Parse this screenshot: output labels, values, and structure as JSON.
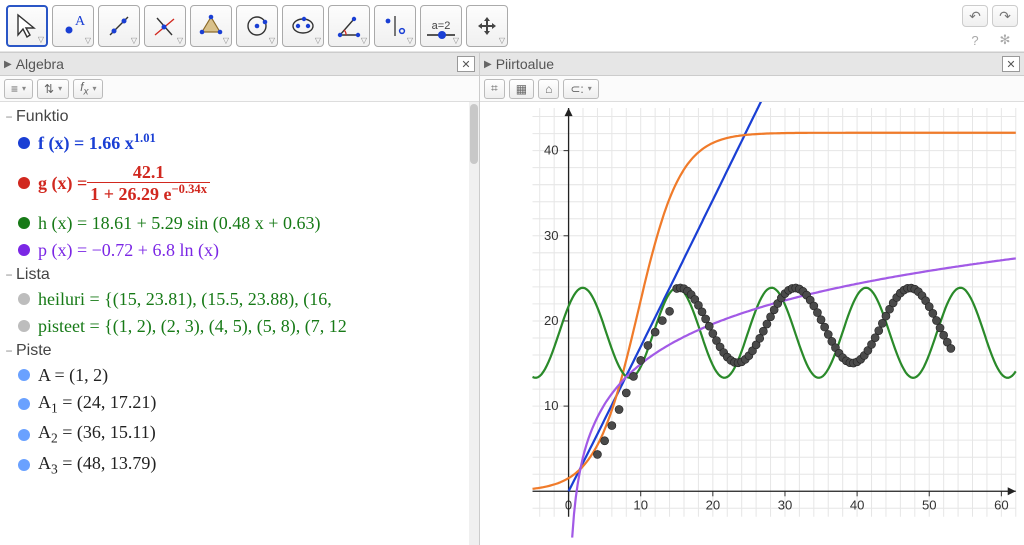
{
  "panels": {
    "algebra": {
      "title": "Algebra"
    },
    "graphics": {
      "title": "Piirtoalue"
    }
  },
  "algebra": {
    "categories": {
      "funktio": "Funktio",
      "lista": "Lista",
      "piste": "Piste"
    },
    "funktio": {
      "f": {
        "lhs": "f (x)  =  ",
        "coef": "1.66 x",
        "exp": "1.01"
      },
      "g": {
        "lhs": "g (x)  =  ",
        "num": "42.1",
        "denA": "1 + 26.29 e",
        "denExp": "−0.34x"
      },
      "h": {
        "expr": "h (x)  =  18.61 + 5.29  sin (0.48 x + 0.63)"
      },
      "p": {
        "expr": "p (x)  =  −0.72 + 6.8  ln (x)"
      }
    },
    "lista": {
      "heiluri": "heiluri = {(15, 23.81), (15.5, 23.88), (16,",
      "pisteet": "pisteet = {(1, 2), (2, 3), (4, 5), (5, 8), (7, 12"
    },
    "piste": {
      "A": "A  =  (1, 2)",
      "A1": {
        "pre": "A",
        "sub": "1",
        "rest": "  =  (24, 17.21)"
      },
      "A2": {
        "pre": "A",
        "sub": "2",
        "rest": "  =  (36, 15.11)"
      },
      "A3": {
        "pre": "A",
        "sub": "3",
        "rest": "  =  (48, 13.79)"
      }
    }
  },
  "toolbar": {
    "azLabel": "a=2"
  },
  "chart_data": {
    "type": "line+scatter",
    "xlim": [
      -5,
      62
    ],
    "ylim": [
      -3,
      45
    ],
    "xticks": [
      0,
      10,
      20,
      30,
      40,
      50,
      60
    ],
    "yticks": [
      10,
      20,
      30,
      40
    ],
    "series": [
      {
        "name": "f(x)=1.66x^1.01",
        "color": "#1a3fd4",
        "fn": "1.66*Math.pow(x,1.01)",
        "clip_y": 60
      },
      {
        "name": "g(x)=42.1/(1+26.29e^-0.34x)",
        "color": "#f07b2a",
        "fn": "42.1/(1+26.29*Math.exp(-0.34*x))"
      },
      {
        "name": "h(x)=18.61+5.29sin(0.48x+0.63)",
        "color": "#2a8a2a",
        "fn": "18.61+5.29*Math.sin(0.48*x+0.63)"
      },
      {
        "name": "p(x)=-0.72+6.8ln(x)",
        "color": "#a25ae6",
        "fn": "-0.72+6.8*Math.log(x)",
        "xmin": 0.5
      }
    ],
    "points": [
      [
        4,
        4.32
      ],
      [
        5,
        5.93
      ],
      [
        6,
        7.71
      ],
      [
        7,
        9.6
      ],
      [
        8,
        11.55
      ],
      [
        9,
        13.49
      ],
      [
        10,
        15.37
      ],
      [
        11,
        17.12
      ],
      [
        12,
        18.69
      ],
      [
        13,
        20.04
      ],
      [
        14,
        21.13
      ],
      [
        15,
        23.81
      ],
      [
        15.5,
        23.88
      ],
      [
        16,
        23.78
      ],
      [
        16.5,
        23.51
      ],
      [
        17,
        23.09
      ],
      [
        17.5,
        22.52
      ],
      [
        18,
        21.84
      ],
      [
        18.5,
        21.07
      ],
      [
        19,
        20.24
      ],
      [
        19.5,
        19.38
      ],
      [
        20,
        18.52
      ],
      [
        20.5,
        17.7
      ],
      [
        21,
        16.95
      ],
      [
        21.5,
        16.29
      ],
      [
        22,
        15.76
      ],
      [
        22.5,
        15.37
      ],
      [
        23,
        15.14
      ],
      [
        23.5,
        15.09
      ],
      [
        24,
        15.2
      ],
      [
        24.5,
        15.49
      ],
      [
        25,
        15.92
      ],
      [
        25.5,
        16.5
      ],
      [
        26,
        17.19
      ],
      [
        26.5,
        17.96
      ],
      [
        27,
        18.79
      ],
      [
        27.5,
        19.64
      ],
      [
        28,
        20.49
      ],
      [
        28.5,
        21.31
      ],
      [
        29,
        22.05
      ],
      [
        29.5,
        22.7
      ],
      [
        30,
        23.22
      ],
      [
        30.5,
        23.6
      ],
      [
        31,
        23.82
      ],
      [
        31.5,
        23.87
      ],
      [
        32,
        23.75
      ],
      [
        32.5,
        23.47
      ],
      [
        33,
        23.03
      ],
      [
        33.5,
        22.45
      ],
      [
        34,
        21.76
      ],
      [
        34.5,
        20.98
      ],
      [
        35,
        20.14
      ],
      [
        35.5,
        19.28
      ],
      [
        36,
        18.42
      ],
      [
        36.5,
        17.6
      ],
      [
        37,
        16.86
      ],
      [
        37.5,
        16.21
      ],
      [
        38,
        15.69
      ],
      [
        38.5,
        15.32
      ],
      [
        39,
        15.1
      ],
      [
        39.5,
        15.06
      ],
      [
        40,
        15.2
      ],
      [
        40.5,
        15.5
      ],
      [
        41,
        15.95
      ],
      [
        41.5,
        16.54
      ],
      [
        42,
        17.24
      ],
      [
        42.5,
        18.03
      ],
      [
        43,
        18.86
      ],
      [
        43.5,
        19.72
      ],
      [
        44,
        20.57
      ],
      [
        44.5,
        21.38
      ],
      [
        45,
        22.12
      ],
      [
        45.5,
        22.76
      ],
      [
        46,
        23.27
      ],
      [
        46.5,
        23.63
      ],
      [
        47,
        23.83
      ],
      [
        47.5,
        23.86
      ],
      [
        48,
        23.73
      ],
      [
        48.5,
        23.43
      ],
      [
        49,
        22.97
      ],
      [
        49.5,
        22.38
      ],
      [
        50,
        21.68
      ],
      [
        50.5,
        20.89
      ],
      [
        51,
        20.05
      ],
      [
        51.5,
        19.18
      ],
      [
        52,
        18.32
      ],
      [
        52.5,
        17.51
      ],
      [
        53,
        16.77
      ]
    ]
  }
}
